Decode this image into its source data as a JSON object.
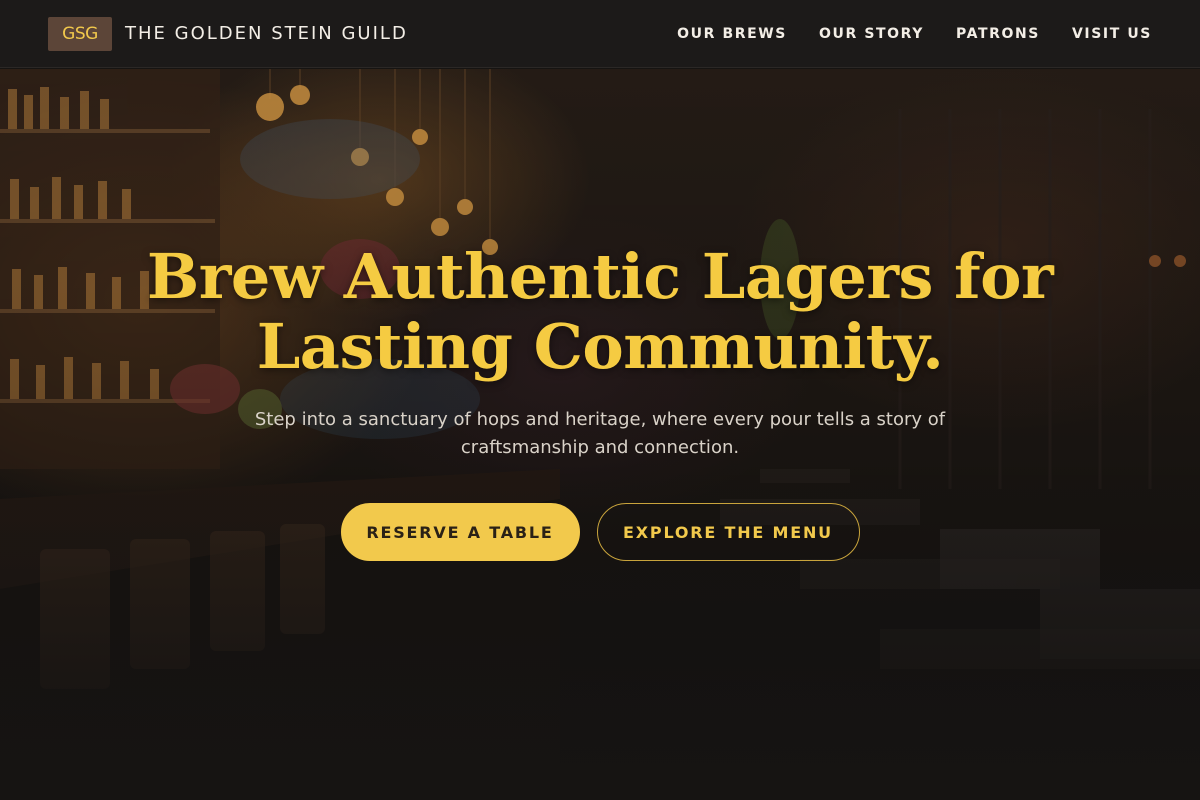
{
  "header": {
    "logo_text": "GSG",
    "brand_name": "THE GOLDEN STEIN GUILD",
    "nav": [
      {
        "label": "OUR BREWS"
      },
      {
        "label": "OUR STORY"
      },
      {
        "label": "PATRONS"
      },
      {
        "label": "VISIT US"
      }
    ]
  },
  "hero": {
    "headline_line1": "Brew Authentic Lagers for",
    "headline_line2": "Lasting Community.",
    "subtitle_line1": "Step into a sanctuary of hops and heritage, where every pour tells a story of",
    "subtitle_line2": "craftsmanship and connection.",
    "primary_cta": "RESERVE A TABLE",
    "secondary_cta": "EXPLORE THE MENU"
  },
  "colors": {
    "accent_gold": "#f2c94c",
    "header_bg": "#1c1a19",
    "logo_bg": "#5c4538",
    "page_bg": "#161412"
  }
}
